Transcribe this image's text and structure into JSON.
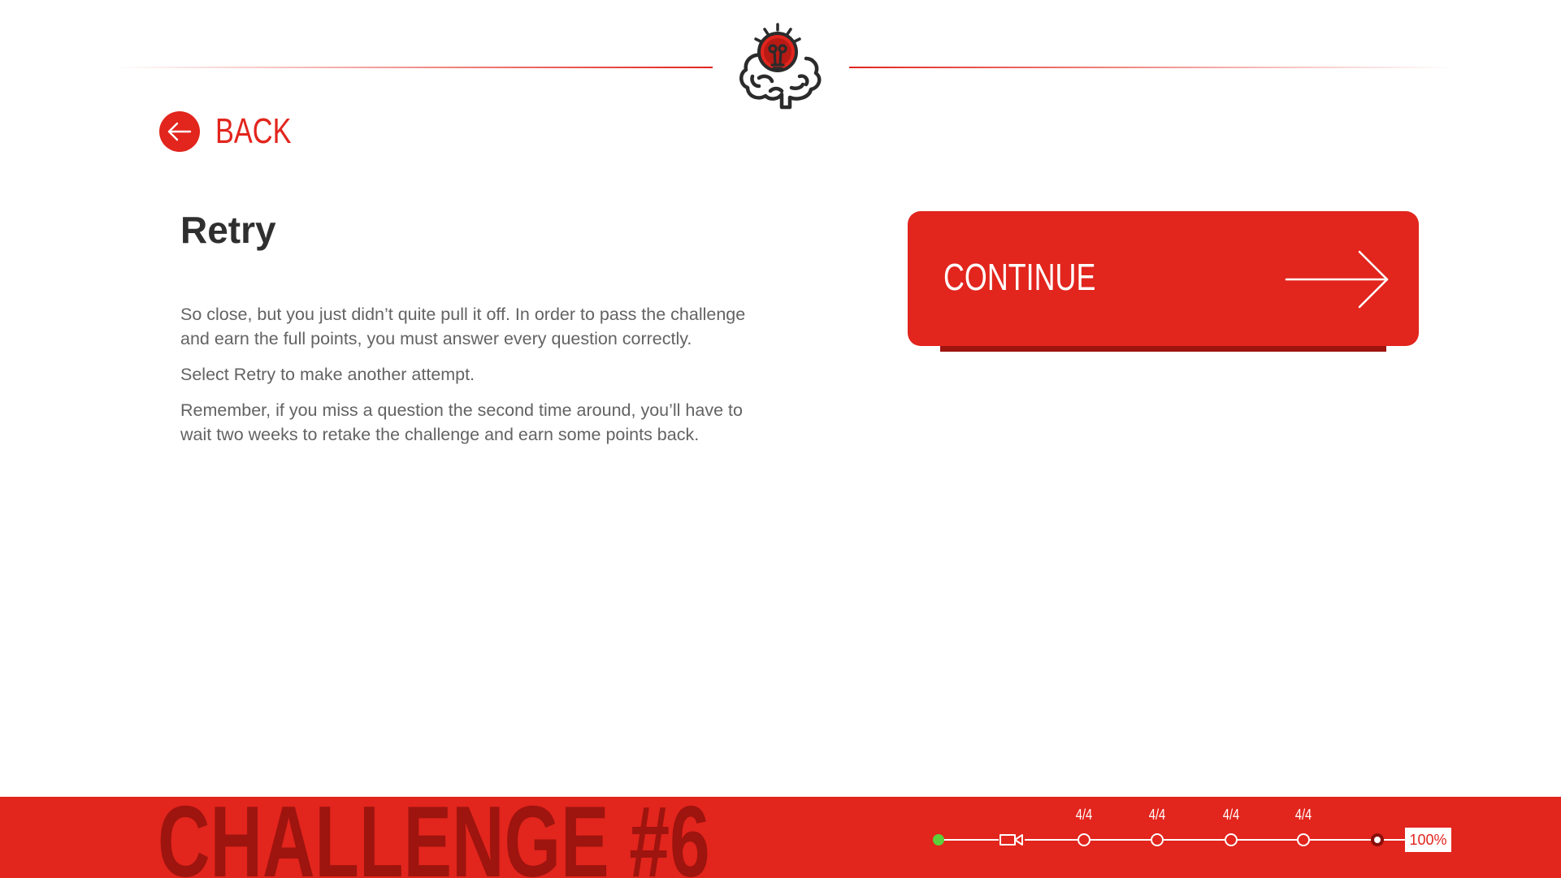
{
  "header": {
    "logo_icon": "brain-lightbulb-icon"
  },
  "back": {
    "label": "BACK",
    "icon": "arrow-left-icon"
  },
  "content": {
    "title": "Retry",
    "paragraphs": [
      "So close, but you just didn’t quite pull it off. In order to pass the challenge and earn the full points, you must answer every question correctly.",
      "Select Retry to make another attempt.",
      "Remember, if you miss a question the second time around, you’ll have to wait two weeks to retake the challenge and earn some points back."
    ]
  },
  "continue": {
    "label": "CONTINUE",
    "icon": "arrow-right-icon"
  },
  "footer": {
    "title": "CHALLENGE #6",
    "progress": {
      "steps": [
        {
          "type": "start",
          "icon": "start-dot-icon"
        },
        {
          "type": "video",
          "icon": "video-camera-icon"
        },
        {
          "type": "quiz",
          "label": "4/4"
        },
        {
          "type": "quiz",
          "label": "4/4"
        },
        {
          "type": "quiz",
          "label": "4/4"
        },
        {
          "type": "quiz",
          "label": "4/4"
        },
        {
          "type": "end",
          "icon": "current-step-icon"
        }
      ],
      "percent_label": "100%",
      "percent": 100
    }
  },
  "colors": {
    "brand_red": "#e2251d",
    "dark_red": "#9e140e",
    "start_green": "#5ccf3b",
    "title_text": "#2f2f2f",
    "body_text": "#636363"
  }
}
